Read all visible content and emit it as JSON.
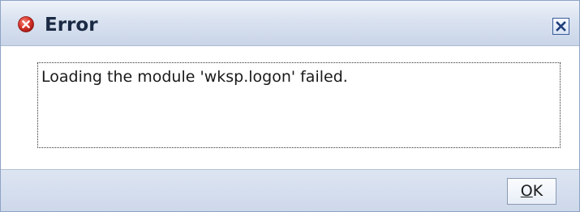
{
  "dialog": {
    "title": "Error",
    "icon": "error-icon",
    "close_icon": "close-icon",
    "message": "Loading the module 'wksp.logon' failed.",
    "ok_mnemonic": "O",
    "ok_rest": "K"
  },
  "colors": {
    "error_red": "#d9342b",
    "title_text": "#1b2a44",
    "close_blue": "#3b5b99"
  }
}
